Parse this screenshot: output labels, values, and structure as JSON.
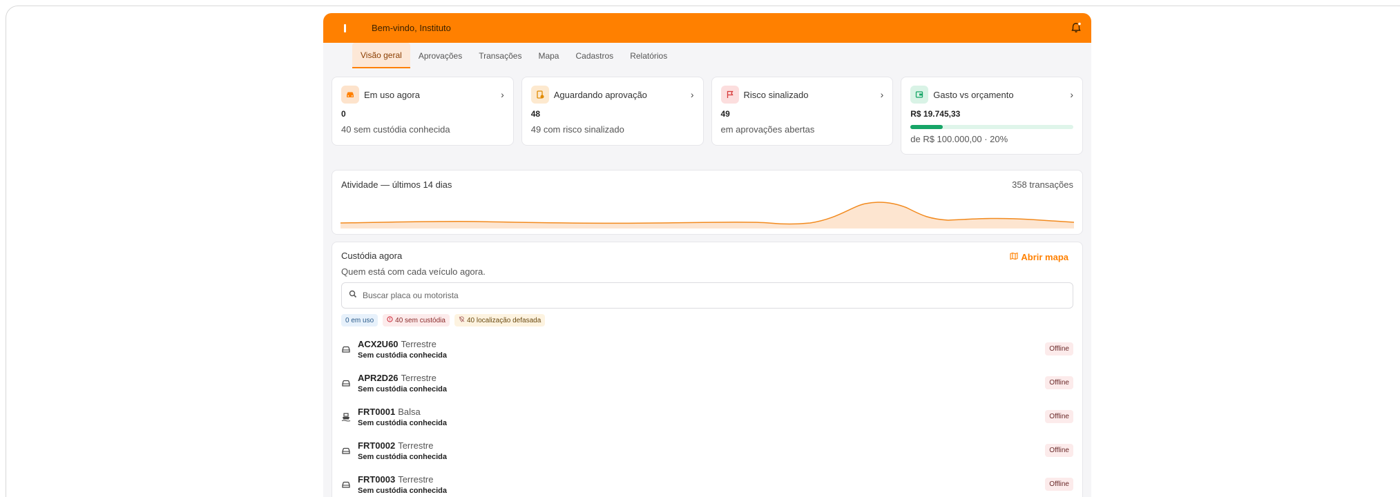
{
  "header": {
    "welcome": "Bem-vindo, Instituto",
    "accent": "#ff8000"
  },
  "tabs": [
    {
      "label": "Visão geral",
      "active": true
    },
    {
      "label": "Aprovações"
    },
    {
      "label": "Transações"
    },
    {
      "label": "Mapa"
    },
    {
      "label": "Cadastros"
    },
    {
      "label": "Relatórios"
    }
  ],
  "cards": [
    {
      "title": "Em uso agora",
      "value": "0",
      "sub": "40 sem custódia conhecida",
      "icon": "car-icon"
    },
    {
      "title": "Aguardando aprovação",
      "value": "48",
      "sub": "49 com risco sinalizado",
      "icon": "pending-approval-icon"
    },
    {
      "title": "Risco sinalizado",
      "value": "49",
      "sub": "em aprovações abertas",
      "icon": "flag-icon"
    },
    {
      "title": "Gasto vs orçamento",
      "value": "R$ 19.745,33",
      "sub": "de R$ 100.000,00 · 20%",
      "progress": 0.2,
      "icon": "wallet-icon"
    }
  ],
  "activity": {
    "title": "Atividade — últimos 14 dias",
    "count": "358 transações"
  },
  "custody": {
    "title": "Custódia agora",
    "subtitle": "Quem está com cada veículo agora.",
    "open_map": "Abrir mapa",
    "search_placeholder": "Buscar placa ou motorista",
    "chips": [
      "0 em uso",
      "40 sem custódia",
      "40 localização defasada"
    ],
    "rows": [
      {
        "plate": "ACX2U60",
        "type": "Terrestre",
        "custody": "Sem custódia conhecida",
        "status": "Offline",
        "icon": "car-icon"
      },
      {
        "plate": "APR2D26",
        "type": "Terrestre",
        "custody": "Sem custódia conhecida",
        "status": "Offline",
        "icon": "car-icon"
      },
      {
        "plate": "FRT0001",
        "type": "Balsa",
        "custody": "Sem custódia conhecida",
        "status": "Offline",
        "icon": "ferry-icon"
      },
      {
        "plate": "FRT0002",
        "type": "Terrestre",
        "custody": "Sem custódia conhecida",
        "status": "Offline",
        "icon": "car-icon"
      },
      {
        "plate": "FRT0003",
        "type": "Terrestre",
        "custody": "Sem custódia conhecida",
        "status": "Offline",
        "icon": "car-icon"
      }
    ]
  }
}
